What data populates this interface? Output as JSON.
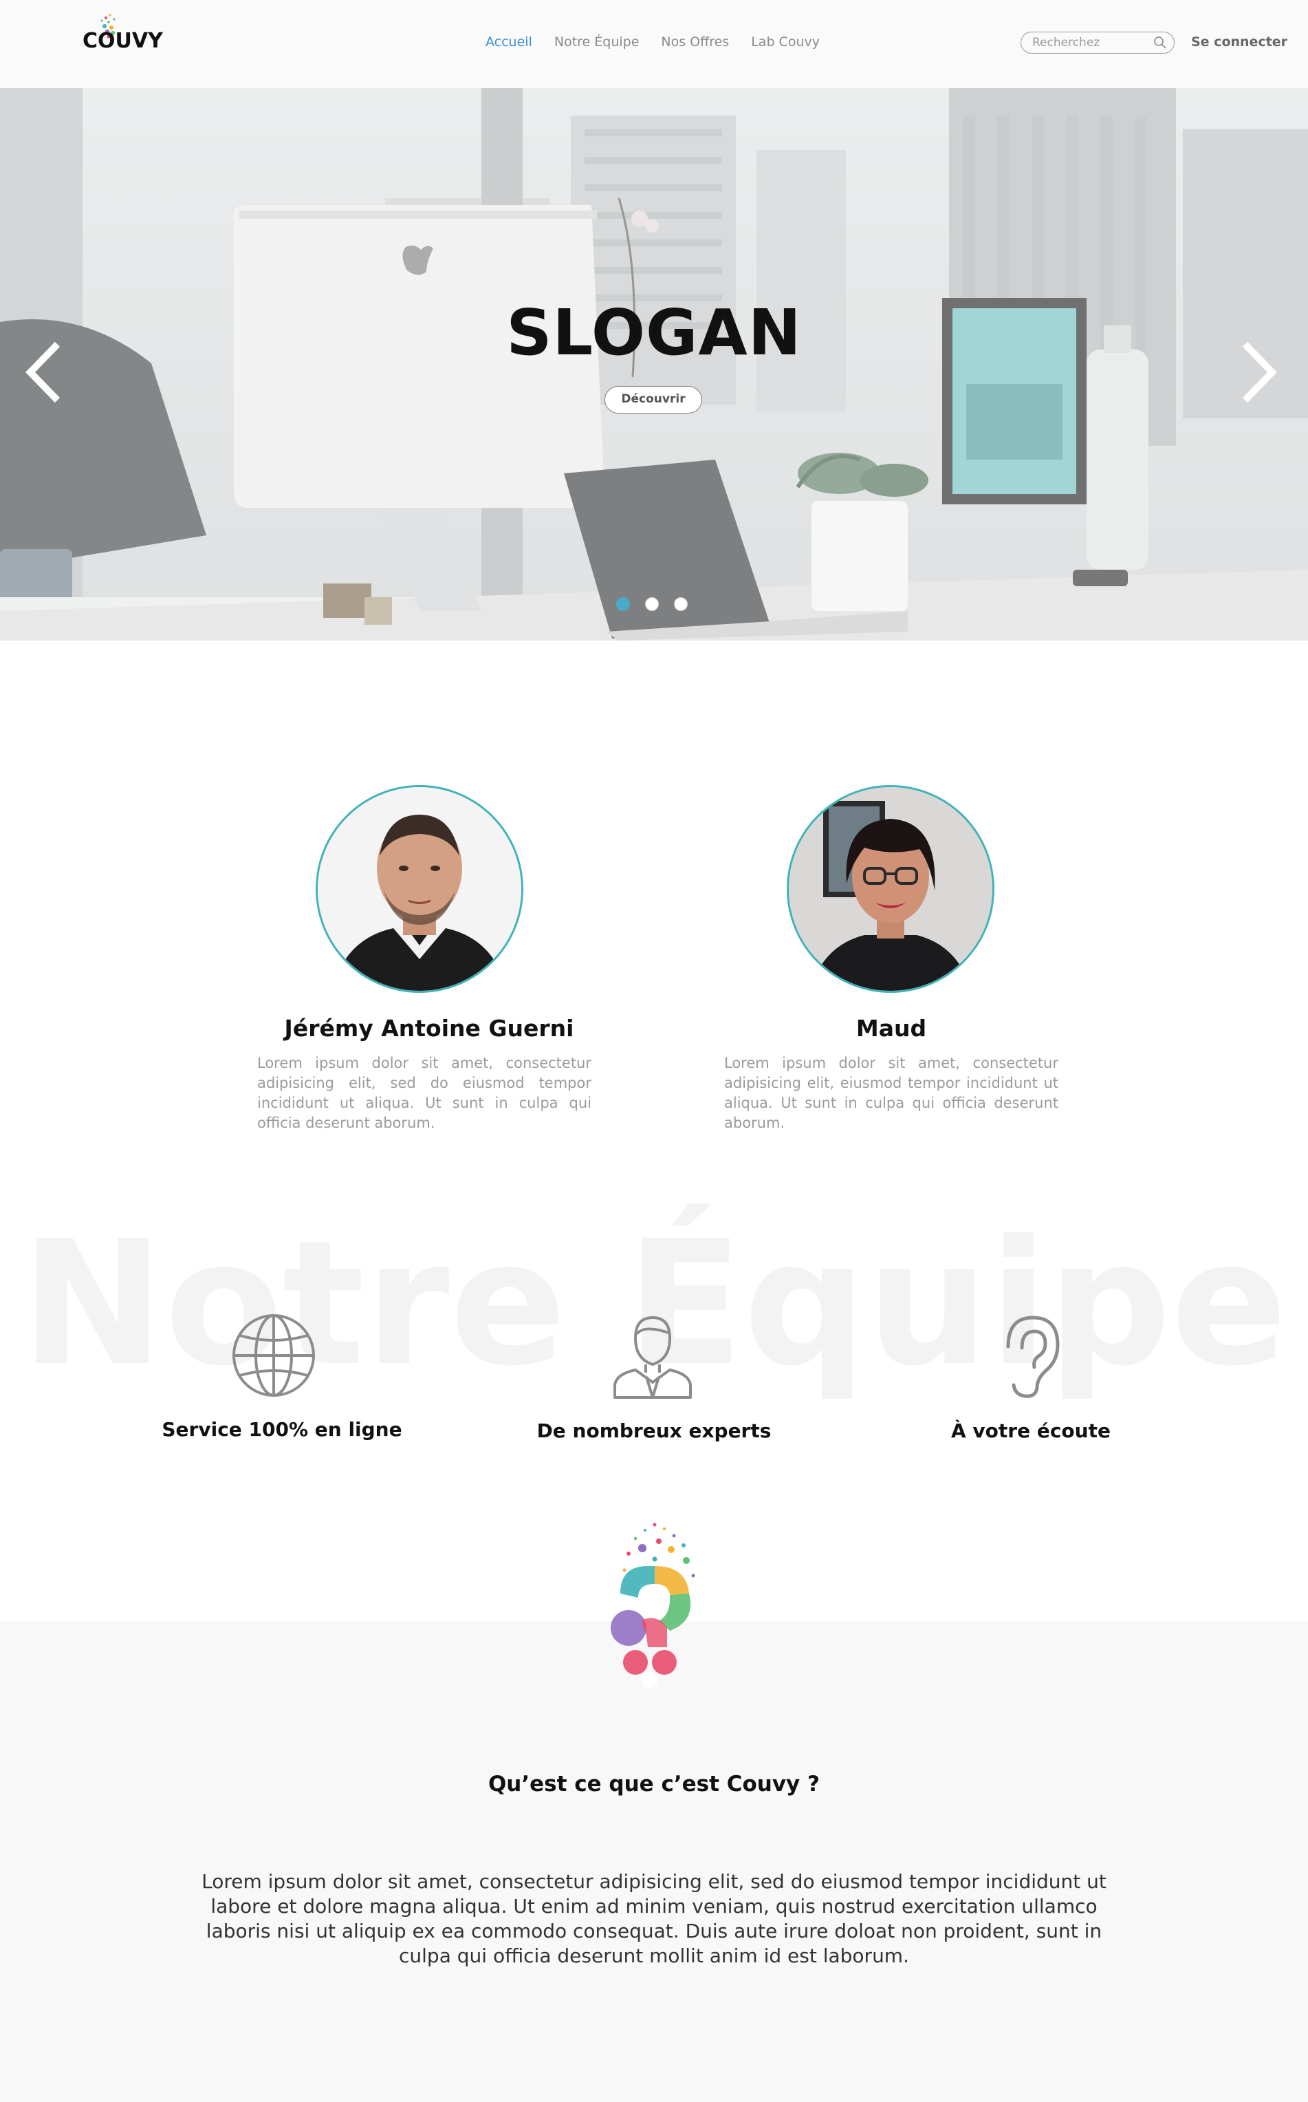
{
  "header": {
    "logo_text": "COUVY",
    "nav": [
      {
        "label": "Accueil",
        "active": true
      },
      {
        "label": "Notre Équipe",
        "active": false
      },
      {
        "label": "Nos Offres",
        "active": false
      },
      {
        "label": "Lab Couvy",
        "active": false
      }
    ],
    "search_placeholder": "Recherchez",
    "login_label": "Se connecter"
  },
  "hero": {
    "slogan": "SLOGAN",
    "cta_label": "Découvrir",
    "slides": 3,
    "active_slide": 1
  },
  "team": [
    {
      "name": "Jérémy Antoine Guerni",
      "bio": "Lorem ipsum dolor sit amet, consectetur adipisicing elit, sed do eiusmod tempor incididunt ut  aliqua. Ut sunt in culpa qui officia deserunt aborum."
    },
    {
      "name": "Maud",
      "bio": "Lorem ipsum dolor sit amet, consectetur adipisicing elit,  eiusmod tempor incididunt ut  aliqua. Ut sunt in culpa qui officia deserunt aborum."
    }
  ],
  "features": {
    "watermark": "Notre Équipe",
    "items": [
      {
        "label": "Service 100% en ligne",
        "icon": "globe-icon"
      },
      {
        "label": "De nombreux experts",
        "icon": "expert-icon"
      },
      {
        "label": "À votre écoute",
        "icon": "ear-icon"
      }
    ]
  },
  "about": {
    "title": "Qu’est ce que c’est Couvy ?",
    "text": "Lorem ipsum dolor sit amet, consectetur adipisicing elit, sed do eiusmod tempor incididunt ut labore et dolore magna aliqua. Ut enim ad minim veniam, quis nostrud exercitation ullamco laboris nisi ut aliquip ex ea commodo consequat. Duis aute irure doloat non proident, sunt in culpa qui officia deserunt mollit anim id est laborum."
  },
  "colors": {
    "accent": "#3a8fd6",
    "avatar_ring": "#3fb3b8",
    "active_dot": "#4aaac8"
  }
}
